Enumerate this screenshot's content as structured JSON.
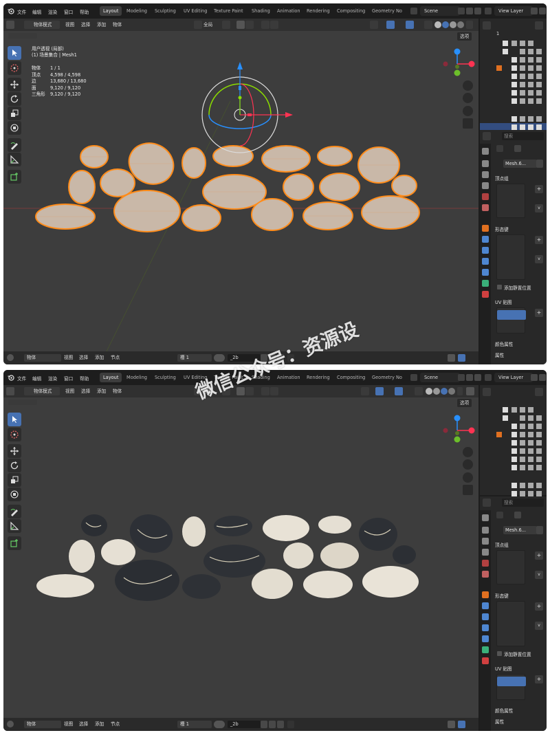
{
  "menu": [
    "文件",
    "编辑",
    "渲染",
    "窗口",
    "帮助"
  ],
  "workspaces": [
    "Layout",
    "Modeling",
    "Sculpting",
    "UV Editing",
    "Texture Paint",
    "Shading",
    "Animation",
    "Rendering",
    "Compositing",
    "Geometry No"
  ],
  "scene": "Scene",
  "view_layer": "View Layer",
  "header": {
    "mode": "物体模式",
    "view": "视图",
    "select": "选择",
    "add": "添加",
    "object": "物体",
    "transform_orient": "全局",
    "options": "选项"
  },
  "overlay": {
    "view_name": "用户透视 (局部)",
    "collection": "(1) 场景集合 | Mesh1",
    "stats": [
      {
        "k": "物体",
        "v": "1 / 1"
      },
      {
        "k": "顶点",
        "v": "4,598 / 4,598"
      },
      {
        "k": "边",
        "v": "13,680 / 13,680"
      },
      {
        "k": "面",
        "v": "9,120 / 9,120"
      },
      {
        "k": "三角形",
        "v": "9,120 / 9,120"
      }
    ]
  },
  "outliner": {
    "root": "1"
  },
  "properties": {
    "search": "搜索",
    "mesh_name": "Mesh.6...",
    "vertex_groups": "顶点组",
    "shape_keys": "形态键",
    "relative": "添加静置位置",
    "uv_maps": "UV 贴图",
    "color_attrs": "颜色属性",
    "attributes": "属性"
  },
  "statusbar": {
    "mode": "物体",
    "view": "视图",
    "select": "选择",
    "add": "添加",
    "node": "节点",
    "slot": "槽 1",
    "material": "_2b"
  },
  "watermark": "微信公众号：资源设",
  "colors": {
    "accent": "#4772b3",
    "selection": "#ff8c1a",
    "viewport": "#3d3d3d",
    "x_axis": "#ff3352",
    "y_axis": "#8bdc00",
    "z_axis": "#2890ff"
  }
}
